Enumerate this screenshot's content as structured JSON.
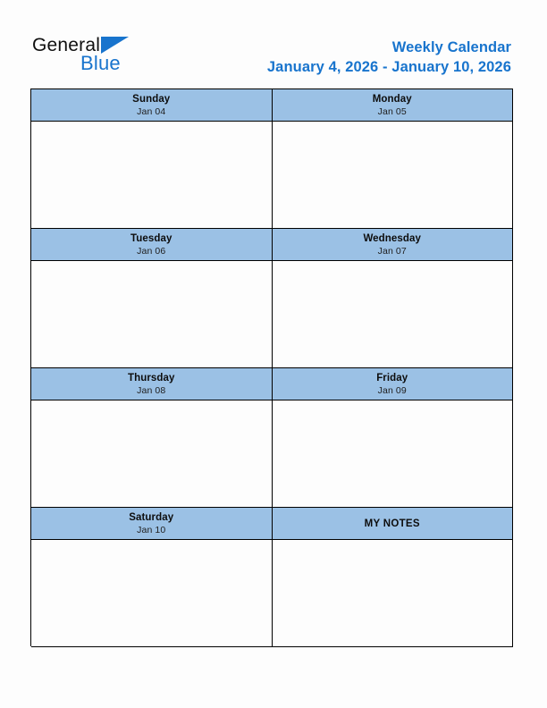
{
  "brand": {
    "word_general": "General",
    "word_blue": "Blue",
    "triangle_icon": "brand-triangle-icon",
    "colors": {
      "general_text": "#101010",
      "blue_text": "#1874cd",
      "triangle": "#1874cd"
    }
  },
  "header": {
    "title": "Weekly Calendar",
    "date_range": "January 4, 2026 - January 10, 2026",
    "title_color": "#1874cd"
  },
  "calendar": {
    "header_bg": "#9bc1e5",
    "border_color": "#000000",
    "cell_bg": "#fdfdfd",
    "rows": [
      {
        "cells": [
          {
            "day": "Sunday",
            "date": "Jan 04",
            "note": ""
          },
          {
            "day": "Monday",
            "date": "Jan 05",
            "note": ""
          }
        ]
      },
      {
        "cells": [
          {
            "day": "Tuesday",
            "date": "Jan 06",
            "note": ""
          },
          {
            "day": "Wednesday",
            "date": "Jan 07",
            "note": ""
          }
        ]
      },
      {
        "cells": [
          {
            "day": "Thursday",
            "date": "Jan 08",
            "note": ""
          },
          {
            "day": "Friday",
            "date": "Jan 09",
            "note": ""
          }
        ]
      },
      {
        "cells": [
          {
            "day": "Saturday",
            "date": "Jan 10",
            "note": ""
          },
          {
            "day": "MY NOTES",
            "date": "",
            "note": ""
          }
        ]
      }
    ]
  }
}
